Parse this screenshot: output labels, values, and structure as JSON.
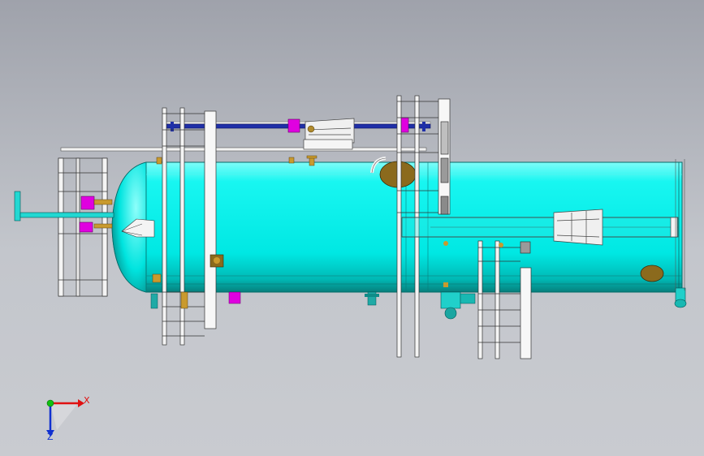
{
  "viewport": {
    "background_top": "#9fa2ab",
    "background_bottom": "#c9cbd0"
  },
  "colors": {
    "vessel": "#00f5f0",
    "vessel_shadow": "#0a8f8c",
    "structure": "#f4f4f4",
    "nozzle_magenta": "#e000e0",
    "pipe_blue": "#1f2fa8",
    "manway_brown": "#8b6a1d",
    "nozzle_gold": "#c99a2e"
  },
  "triad": {
    "x_label": "X",
    "z_label": "Z",
    "x_color": "#e01010",
    "y_color": "#10c010",
    "z_color": "#1030d0"
  }
}
